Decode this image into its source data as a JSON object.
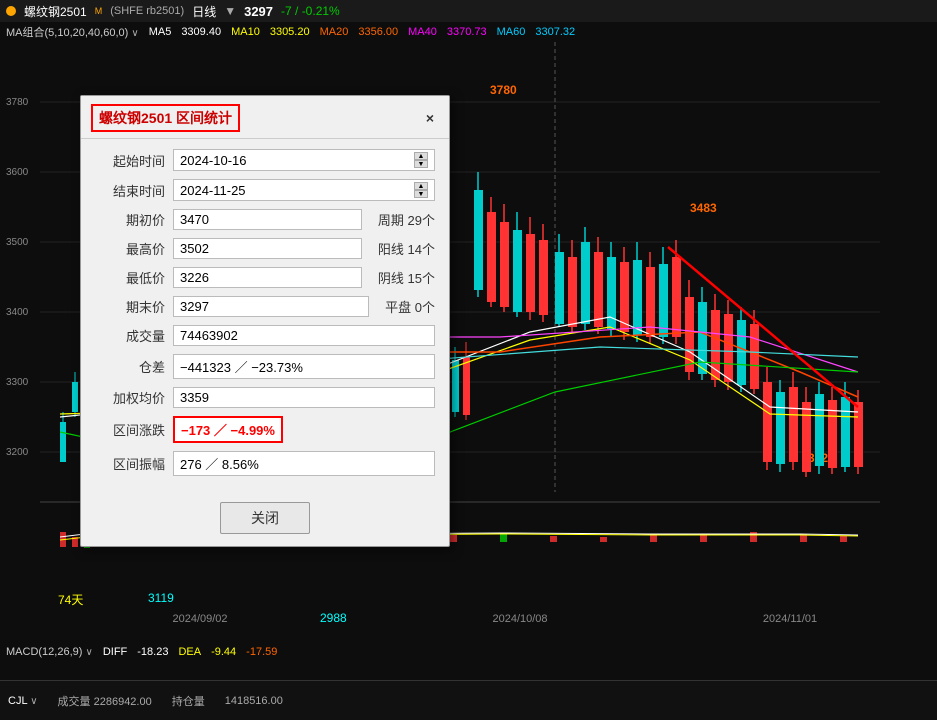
{
  "topbar": {
    "dot_color": "#ffa500",
    "title": "螺纹钢2501",
    "superscript": "M",
    "code": "(SHFE rb2501)",
    "period": "日线",
    "price": "3297",
    "change": "-7 / -0.21%"
  },
  "ma_bar": {
    "label": "MA组合(5,10,20,40,60,0)",
    "ma5_label": "MA5",
    "ma5_val": "3309.40",
    "ma10_label": "MA10",
    "ma10_val": "3305.20",
    "ma20_label": "MA20",
    "ma20_val": "3356.00",
    "ma40_label": "MA40",
    "ma40_val": "3370.73",
    "ma60_label": "MA60",
    "ma60_val": "3307.32"
  },
  "dialog": {
    "title": "螺纹钢2501 区间统计",
    "close_label": "×",
    "fields": [
      {
        "label": "起始时间",
        "value": "2024-10-16",
        "type": "date"
      },
      {
        "label": "结束时间",
        "value": "2024-11-25",
        "type": "date"
      },
      {
        "label": "期初价",
        "value": "3470"
      },
      {
        "label": "最高价",
        "value": "3502"
      },
      {
        "label": "最低价",
        "value": "3226"
      },
      {
        "label": "期末价",
        "value": "3297"
      },
      {
        "label": "成交量",
        "value": "74463902"
      },
      {
        "label": "仓差",
        "value": "−441323 ／ −23.73%"
      },
      {
        "label": "加权均价",
        "value": "3359"
      },
      {
        "label": "区间涨跌",
        "value": "−173 ／ −4.99%",
        "highlighted": true
      },
      {
        "label": "区间振幅",
        "value": "276 ／ 8.56%"
      }
    ],
    "side_stats": [
      {
        "label": "周期",
        "value": "29个"
      },
      {
        "label": "阳线",
        "value": "14个"
      },
      {
        "label": "阴线",
        "value": "15个"
      },
      {
        "label": "平盘",
        "value": "0个"
      }
    ],
    "close_btn": "关闭"
  },
  "chart": {
    "price_3780": "3780",
    "price_3483": "3483",
    "price_3400": "3400",
    "price_3226_label": "3226",
    "price_3200": "3200",
    "price_3119": "3119",
    "price_2988": "2988",
    "days_label": "74天",
    "x_labels": [
      "2024/09/02",
      "2024/10/08",
      "2024/11/01"
    ]
  },
  "macd": {
    "label": "MACD(12,26,9)",
    "diff_label": "DIFF",
    "diff_val": "-18.23",
    "dea_label": "DEA",
    "dea_val": "-9.44",
    "macd_val": "-17.59"
  },
  "bottom": {
    "cjl_label": "CJL",
    "cjl_val": "成交量 2286942.00",
    "ccl_label": "持仓量",
    "ccl_val": "1418516.00"
  }
}
